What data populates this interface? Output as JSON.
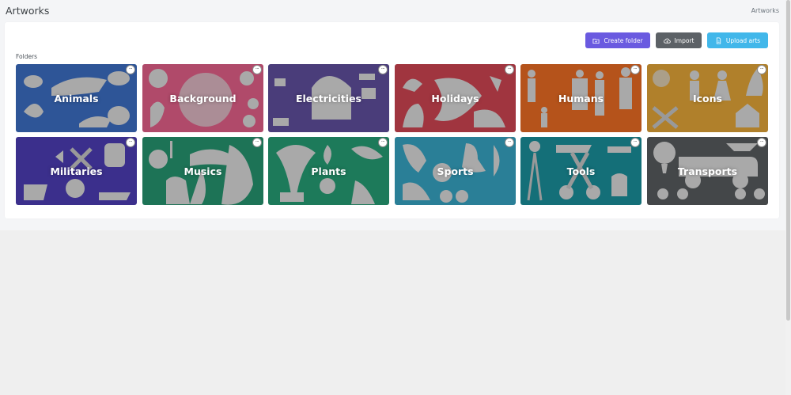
{
  "page": {
    "title": "Artworks",
    "breadcrumb": "Artworks"
  },
  "toolbar": {
    "create_folder": "Create folder",
    "import": "Import",
    "upload_arts": "Upload arts"
  },
  "folders_label": "Folders",
  "folder_menu_icon": "···",
  "folders": [
    {
      "name": "Animals",
      "color": "#2e5597"
    },
    {
      "name": "Background",
      "color": "#b04a6a"
    },
    {
      "name": "Electricities",
      "color": "#4a3d7a"
    },
    {
      "name": "Holidays",
      "color": "#a0353f"
    },
    {
      "name": "Humans",
      "color": "#b5531b"
    },
    {
      "name": "Icons",
      "color": "#b0802b"
    },
    {
      "name": "Militaries",
      "color": "#3b2f8c"
    },
    {
      "name": "Musics",
      "color": "#1d7356"
    },
    {
      "name": "Plants",
      "color": "#1d7a5a"
    },
    {
      "name": "Sports",
      "color": "#2a7f97"
    },
    {
      "name": "Tools",
      "color": "#146f78"
    },
    {
      "name": "Transports",
      "color": "#444749"
    }
  ]
}
